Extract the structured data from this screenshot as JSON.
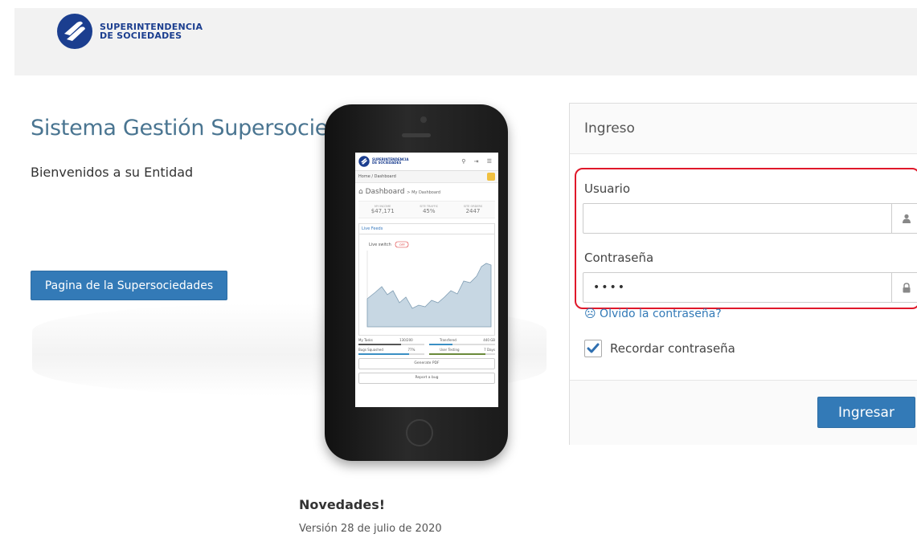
{
  "header": {
    "logo_line1": "SUPERINTENDENCIA",
    "logo_line2": "DE SOCIEDADES"
  },
  "intro": {
    "title": "Sistema Gestión Supersociedades",
    "welcome": "Bienvenidos a su Entidad",
    "portal_button": "Pagina de la Supersociedades"
  },
  "phone_screen": {
    "logo_line1": "SUPERINTENDENCIA",
    "logo_line2": "DE SOCIEDADES",
    "breadcrumb": "Home  /  Dashboard",
    "dashboard_title": "Dashboard",
    "dashboard_sub": "> My Dashboard",
    "stats": [
      {
        "label": "MY INCOME",
        "value": "$47,171"
      },
      {
        "label": "SITE TRAFFIC",
        "value": "45%"
      },
      {
        "label": "SITE ORDERS",
        "value": "2447"
      }
    ],
    "feeds_tab": "Live Feeds",
    "live_switch": "Live switch",
    "live_switch_state": "OFF",
    "progress": [
      {
        "left": "My Tasks",
        "left_val": "130/200",
        "right": "Transfered",
        "right_val": "440 GB",
        "left_fill": 0.65,
        "right_fill": 0.35
      },
      {
        "left": "Bugs Squashed",
        "left_val": "77%",
        "right": "User Testing",
        "right_val": "7 Days",
        "left_fill": 0.77,
        "right_fill": 0.85
      }
    ],
    "buttons": [
      "Generate PDF",
      "Report a bug"
    ],
    "accent": "#1b3e8f"
  },
  "login": {
    "heading": "Ingreso",
    "username_label": "Usuario",
    "username_value": "",
    "password_label": "Contraseña",
    "password_value": "••••",
    "forgot_link": "☹ Olvido la contraseña?",
    "remember_label": "Recordar contraseña",
    "remember_checked": true,
    "submit_button": "Ingresar",
    "highlight_color": "#e0182a",
    "button_color": "#337ab7"
  },
  "news": {
    "title": "Novedades!",
    "version": "Versión 28 de julio de 2020"
  }
}
